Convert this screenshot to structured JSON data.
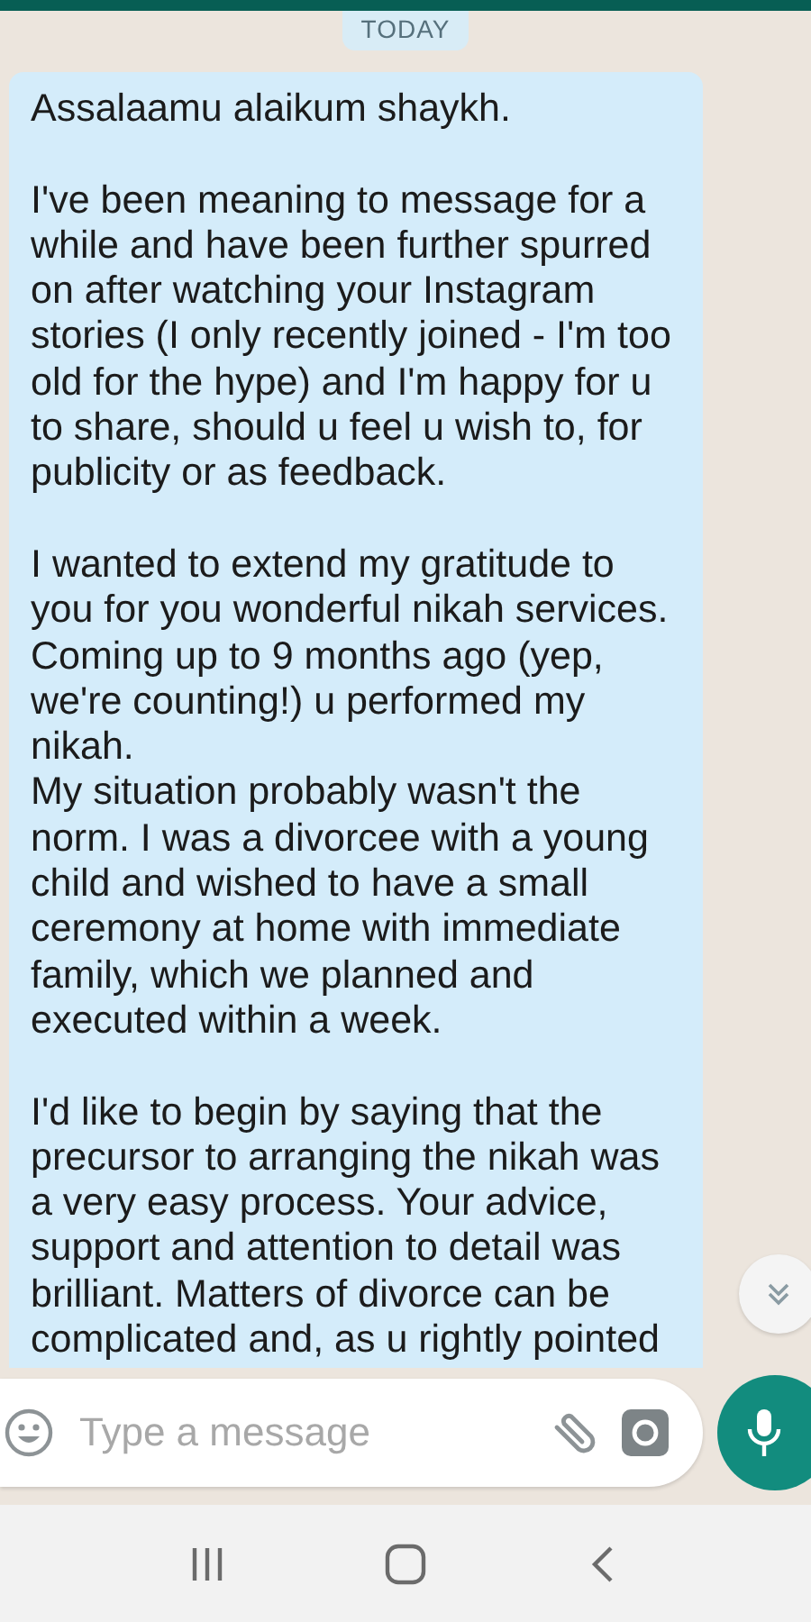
{
  "date_chip": "TODAY",
  "messages": [
    {
      "text": "Assalaamu alaikum shaykh.\n\nI've been meaning to message for a while and have been further spurred on after watching your Instagram stories (I only recently joined - I'm too old for the hype) and I'm happy for u to share, should u feel u wish to, for publicity or as feedback.\n\nI wanted to extend my gratitude to you for you wonderful nikah services. Coming up to 9 months ago (yep, we're counting!) u performed my nikah.\nMy situation probably wasn't the norm. I was a divorcee with a young child and wished to have a small ceremony at home with immediate family, which we planned and executed within a week.\n\nI'd like to begin by saying that the precursor to arranging the nikah was a very easy process. Your advice, support and attention to detail was brilliant. Matters of divorce can be complicated and, as u rightly pointed"
    }
  ],
  "composer": {
    "placeholder": "Type a message"
  }
}
